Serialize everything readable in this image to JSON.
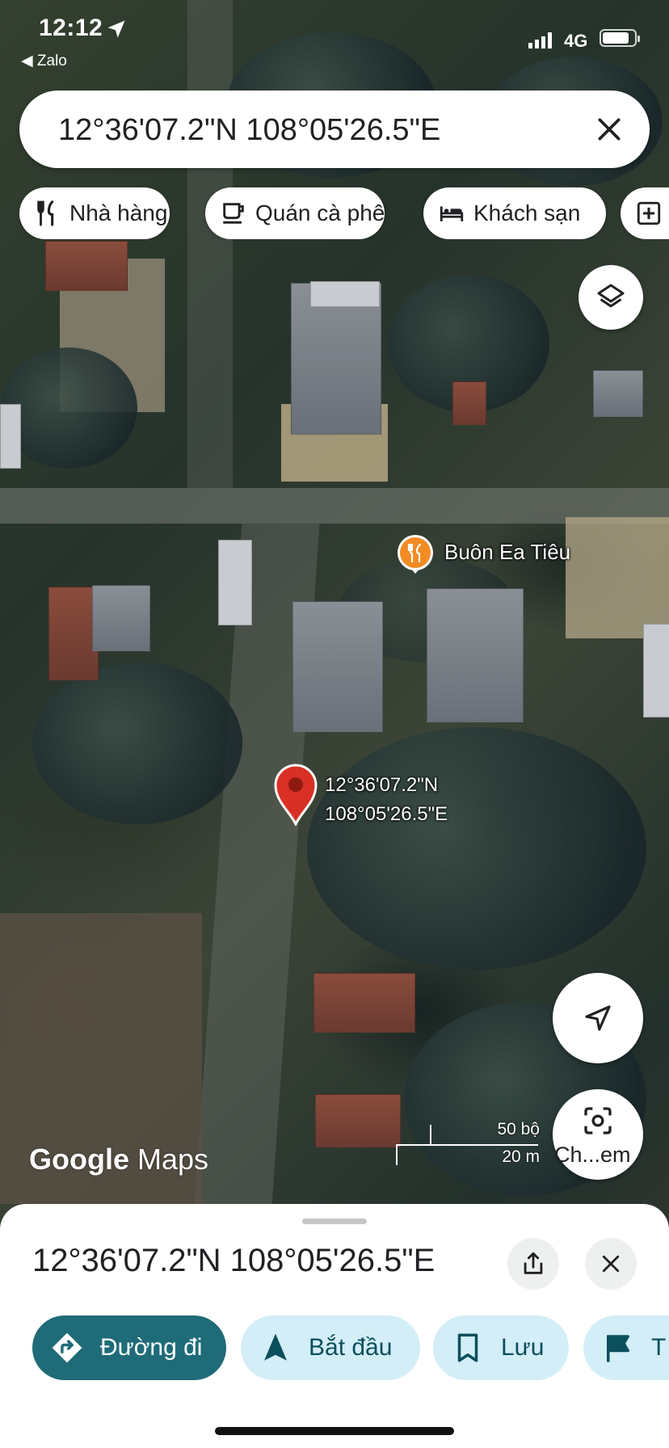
{
  "status_bar": {
    "time": "12:12",
    "back_app": "◀ Zalo",
    "network": "4G",
    "battery_level": 0.85
  },
  "search": {
    "query": "12°36'07.2\"N 108°05'26.5\"E"
  },
  "chips": [
    {
      "label": "Nhà hàng",
      "icon": "restaurant-icon"
    },
    {
      "label": "Quán cà phê",
      "icon": "coffee-icon"
    },
    {
      "label": "Khách sạn",
      "icon": "hotel-icon"
    },
    {
      "label": "",
      "icon": "add-box-icon"
    }
  ],
  "map": {
    "poi_label": "Buôn Ea Tiêu",
    "pin_lat": "12°36'07.2\"N",
    "pin_lng": "108°05'26.5\"E",
    "logo_google": "Google",
    "logo_maps": "Maps",
    "scale_upper": "50 bộ",
    "scale_lower": "20 m",
    "lens_label": "Ch...em",
    "accent_pin": "#d93025",
    "accent_poi": "#f28b24"
  },
  "sheet": {
    "title": "12°36'07.2\"N 108°05'26.5\"E",
    "actions": [
      {
        "label": "Đường đi",
        "icon": "directions-icon"
      },
      {
        "label": "Bắt đầu",
        "icon": "navigation-icon"
      },
      {
        "label": "Lưu",
        "icon": "bookmark-icon"
      },
      {
        "label": "T",
        "icon": "flag-icon"
      }
    ],
    "primary_color": "#1f6b78",
    "secondary_color": "#d3eef7"
  }
}
